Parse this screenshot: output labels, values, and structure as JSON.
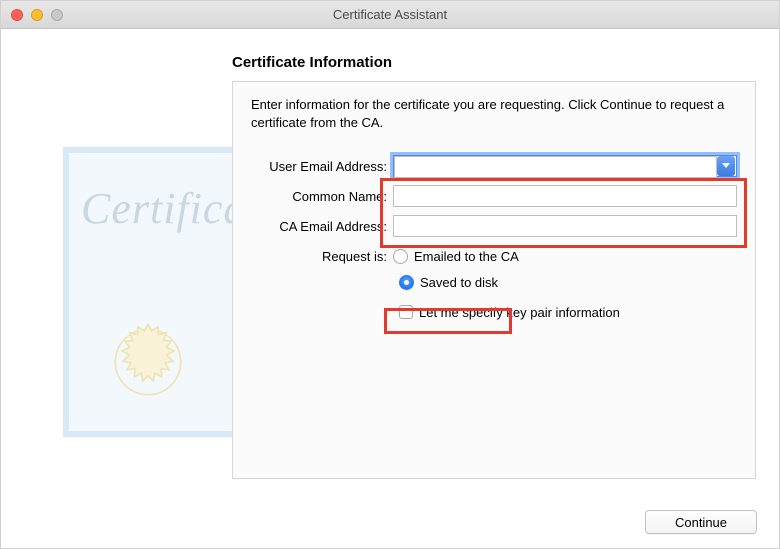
{
  "window": {
    "title": "Certificate Assistant"
  },
  "panel": {
    "title": "Certificate Information",
    "instructions": "Enter information for the certificate you are requesting. Click Continue to request a certificate from the CA."
  },
  "form": {
    "user_email": {
      "label": "User Email Address:",
      "value": ""
    },
    "common_name": {
      "label": "Common Name:",
      "value": ""
    },
    "ca_email": {
      "label": "CA Email Address:",
      "value": ""
    },
    "request_label": "Request is:",
    "opt_emailed": "Emailed to the CA",
    "opt_saved": "Saved to disk",
    "opt_specify": "Let me specify key pair information",
    "selected_request": "saved"
  },
  "footer": {
    "continue": "Continue"
  }
}
